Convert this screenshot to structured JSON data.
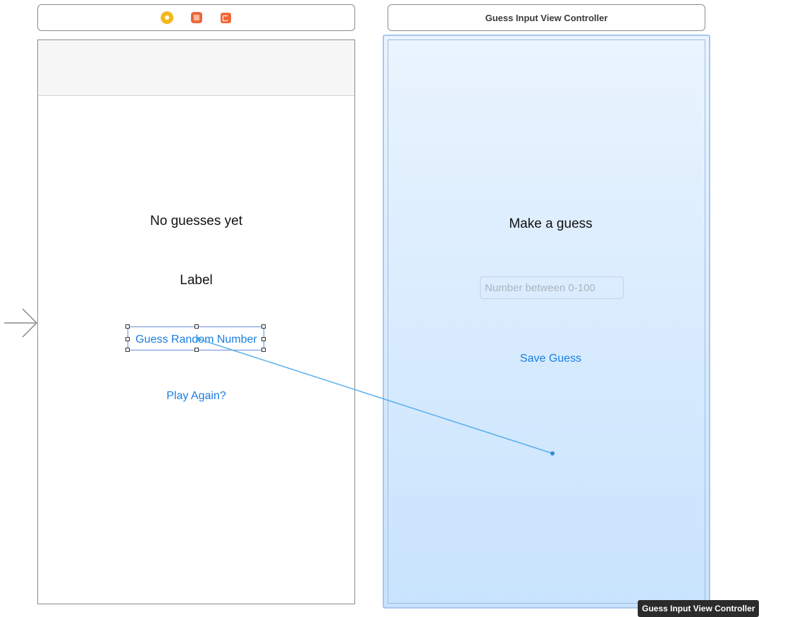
{
  "left_scene": {
    "dock_icons": [
      "view-controller-icon",
      "first-responder-icon",
      "exit-icon"
    ],
    "title_label": "No guesses yet",
    "result_label": "Label",
    "guess_button": "Guess Random Number",
    "play_again_button": "Play Again?"
  },
  "right_scene": {
    "header_title": "Guess Input View Controller",
    "prompt_label": "Make a guess",
    "input_placeholder": "Number between 0-100",
    "save_button": "Save Guess"
  },
  "tooltip": "Guess Input View Controller",
  "colors": {
    "link": "#1a7ee0",
    "connection": "#4aa8ec",
    "highlight_top": "#eaf4fe",
    "highlight_bottom": "#c8e3fd"
  }
}
